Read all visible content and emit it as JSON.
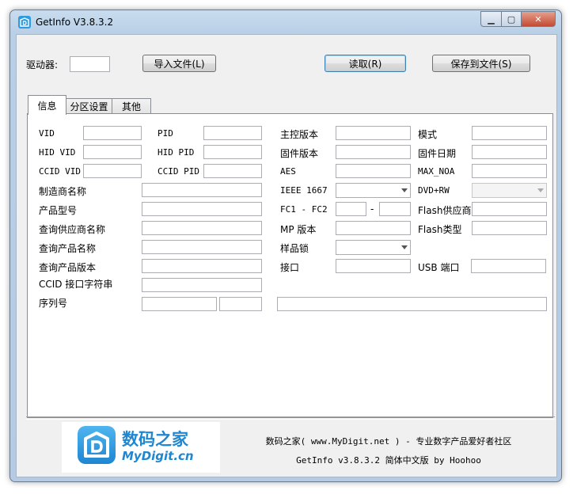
{
  "window": {
    "title": "GetInfo V3.8.3.2"
  },
  "toolbar": {
    "drive_label": "驱动器:",
    "drive_value": "",
    "import_button": "导入文件(L)",
    "read_button": "读取(R)",
    "save_button": "保存到文件(S)"
  },
  "tabs": [
    {
      "label": "信息"
    },
    {
      "label": "分区设置"
    },
    {
      "label": "其他"
    }
  ],
  "labels": {
    "vid": "VID",
    "pid": "PID",
    "controller_version": "主控版本",
    "mode": "模式",
    "hid_vid": "HID VID",
    "hid_pid": "HID PID",
    "firmware_version": "固件版本",
    "firmware_date": "固件日期",
    "ccid_vid": "CCID VID",
    "ccid_pid": "CCID PID",
    "aes": "AES",
    "max_noa": "MAX_NOA",
    "manufacturer_name": "制造商名称",
    "ieee1667": "IEEE 1667",
    "dvd_rw": "DVD+RW",
    "product_model": "产品型号",
    "fc1_fc2": "FC1 - FC2",
    "fc_dash": "-",
    "flash_vendor": "Flash供应商",
    "query_vendor_name": "查询供应商名称",
    "mp_version": "MP 版本",
    "flash_type": "Flash类型",
    "query_product_name": "查询产品名称",
    "sample_lock": "样品锁",
    "query_product_version": "查询产品版本",
    "interface": "接口",
    "usb_port": "USB 端口",
    "ccid_interface_string": "CCID 接口字符串",
    "serial_number": "序列号"
  },
  "footer": {
    "logo_cn": "数码之家",
    "logo_en": "MyDigit.cn",
    "line1": "数码之家( www.MyDigit.net ) - 专业数字产品爱好者社区",
    "line2": "GetInfo v3.8.3.2 简体中文版 by Hoohoo"
  },
  "icons": {
    "app": "getinfo-app-icon",
    "minimize": "minimize-icon",
    "maximize": "maximize-icon",
    "close": "close-icon",
    "dropdown": "chevron-down-icon"
  },
  "colors": {
    "accent": "#1f86d1",
    "titlebar": "#c9dcef",
    "close": "#c44a32"
  }
}
